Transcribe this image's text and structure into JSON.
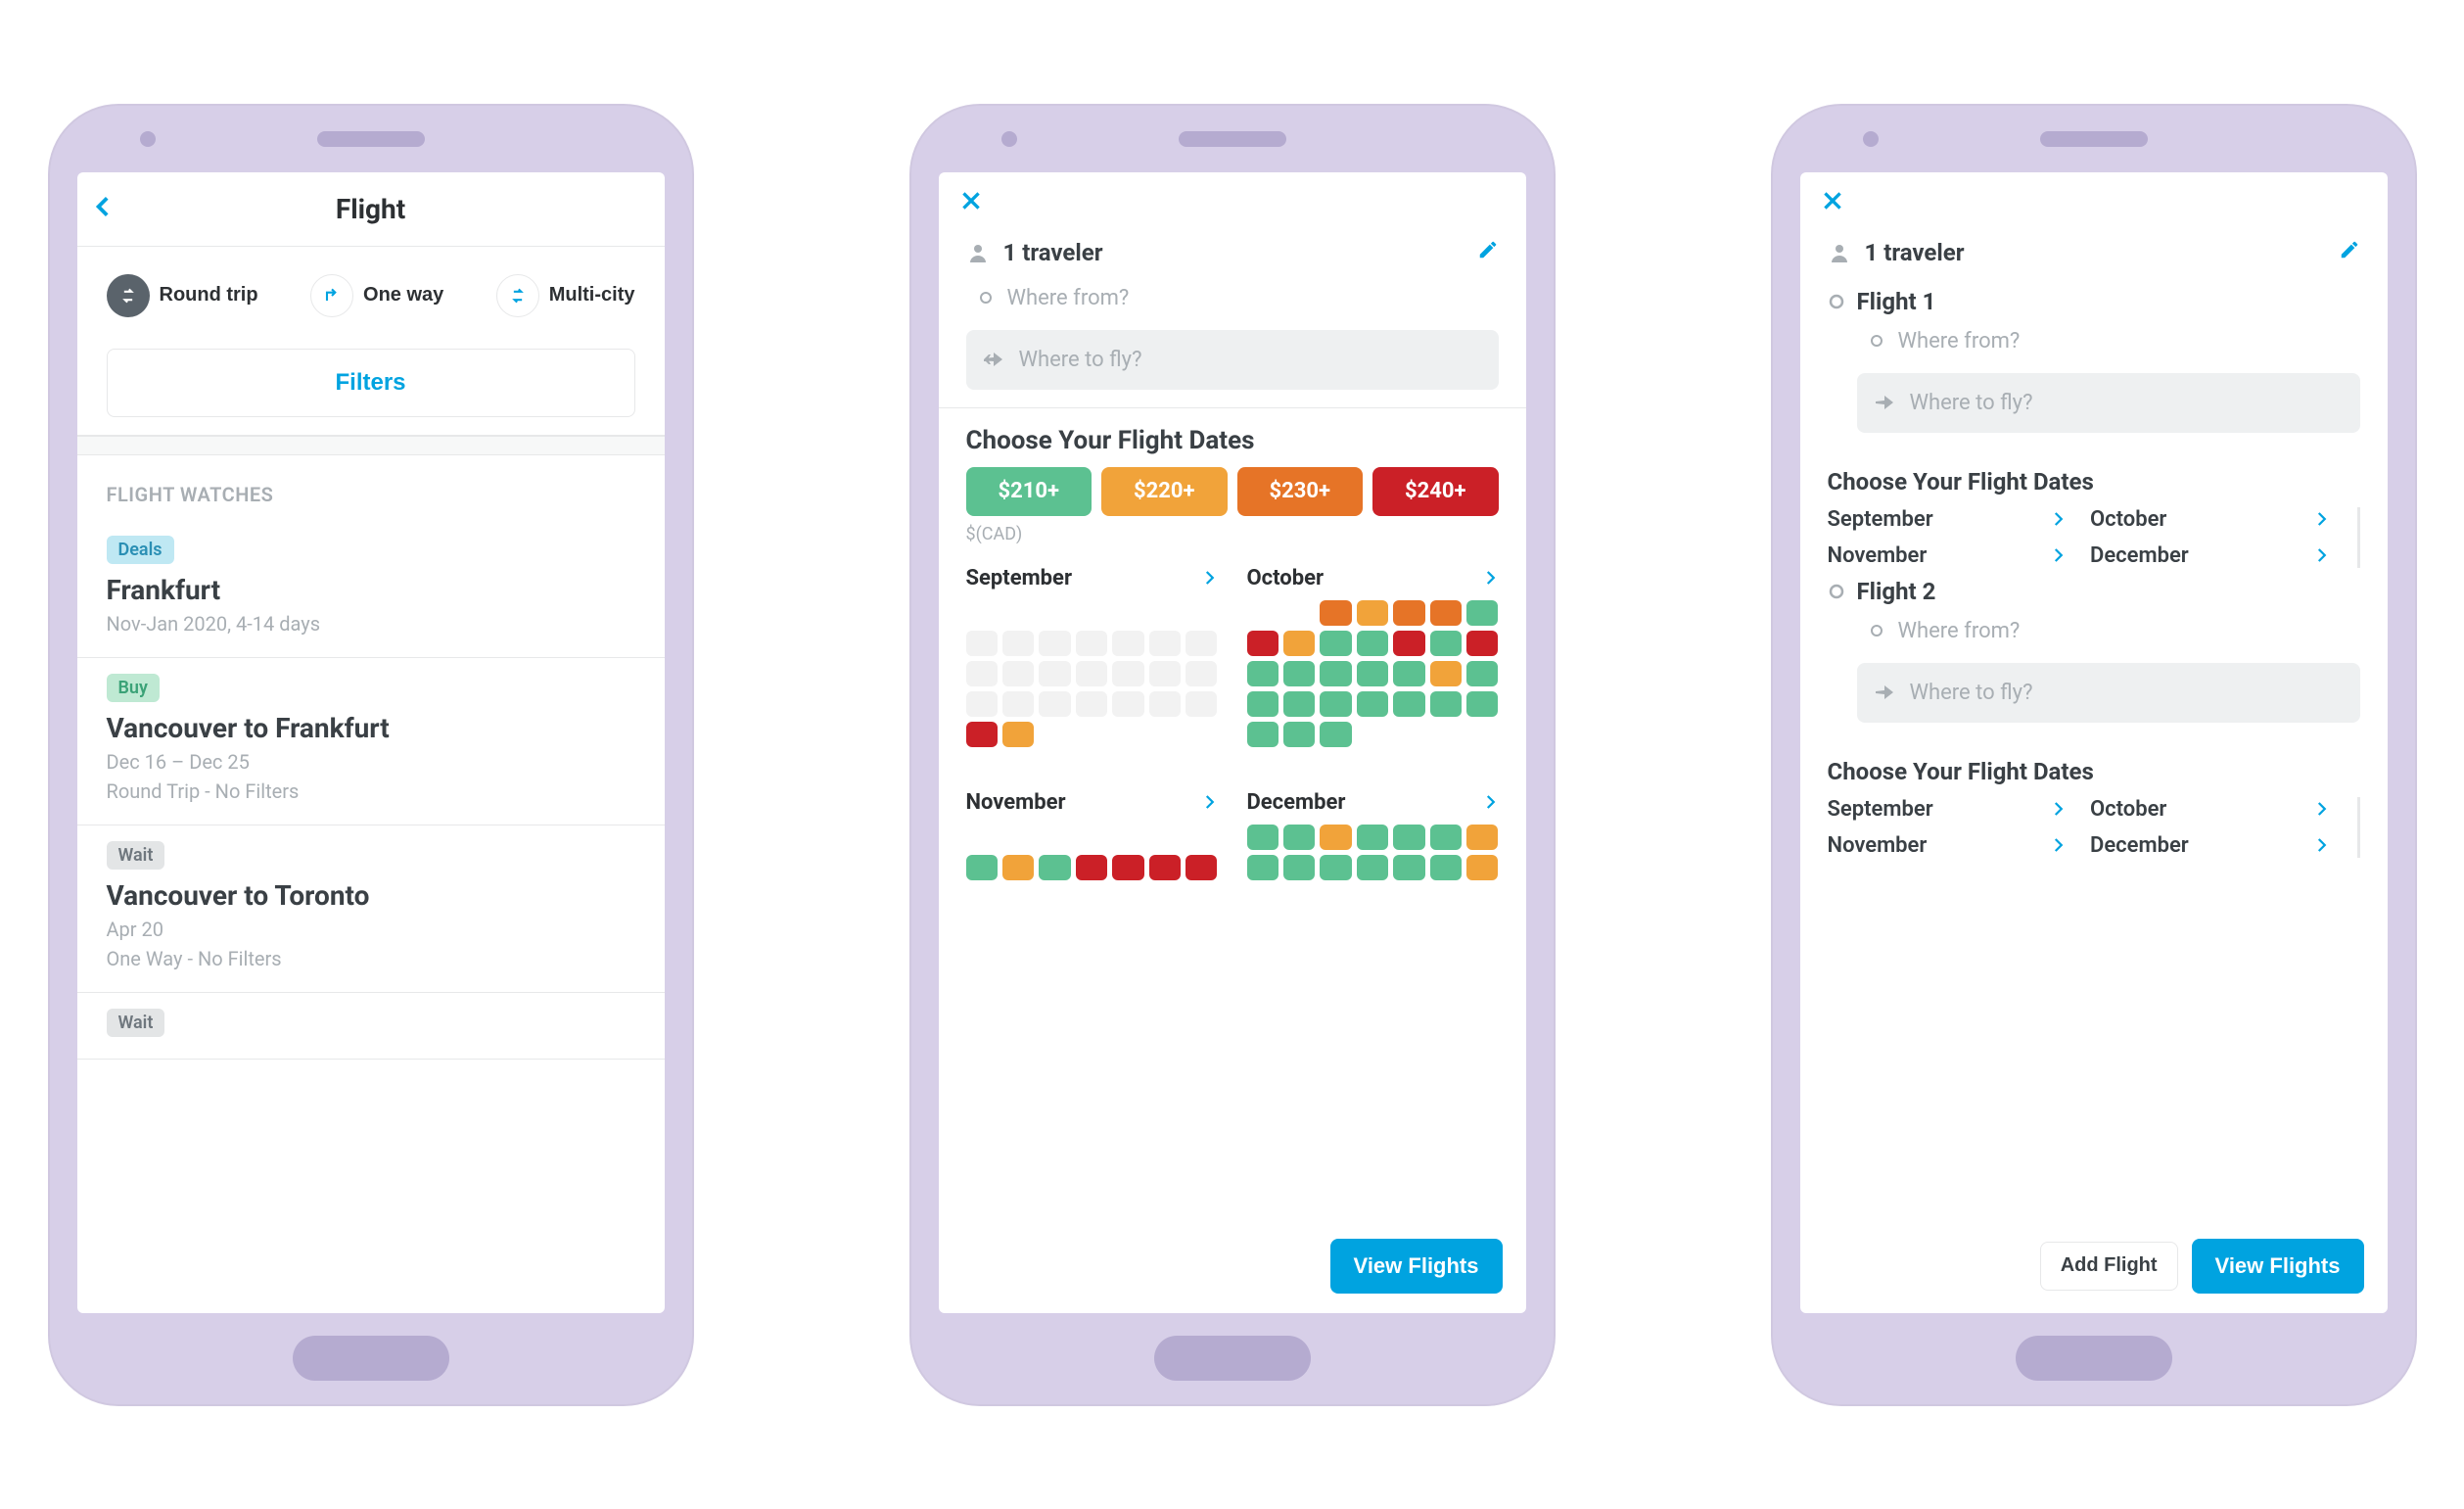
{
  "screen1": {
    "title": "Flight",
    "segments": [
      {
        "icon": "swap",
        "label": "Round trip"
      },
      {
        "icon": "corner",
        "label": "One way"
      },
      {
        "icon": "swap",
        "label": "Multi-city"
      }
    ],
    "filtersLabel": "Filters",
    "watchesHeader": "FLIGHT WATCHES",
    "watches": [
      {
        "badgeType": "deals",
        "badge": "Deals",
        "dest": "Frankfurt",
        "meta1": "Nov-Jan 2020, 4-14 days",
        "meta2": ""
      },
      {
        "badgeType": "buy",
        "badge": "Buy",
        "dest": "Vancouver to Frankfurt",
        "meta1": "Dec 16 – Dec 25",
        "meta2": "Round Trip - No Filters"
      },
      {
        "badgeType": "wait",
        "badge": "Wait",
        "dest": "Vancouver to Toronto",
        "meta1": "Apr 20",
        "meta2": "One Way - No Filters"
      },
      {
        "badgeType": "wait",
        "badge": "Wait",
        "dest": "",
        "meta1": "",
        "meta2": ""
      }
    ]
  },
  "screen2": {
    "traveler": "1 traveler",
    "fromPh": "Where from?",
    "toPh": "Where to fly?",
    "chooseDates": "Choose Your Flight Dates",
    "chips": [
      "$210+",
      "$220+",
      "$230+",
      "$240+"
    ],
    "currency": "$(CAD)",
    "months": [
      {
        "name": "September",
        "cells": [
          "",
          "",
          "",
          "",
          "",
          "",
          "",
          "e",
          "e",
          "e",
          "e",
          "e",
          "e",
          "e",
          "e",
          "e",
          "e",
          "e",
          "e",
          "e",
          "e",
          "e",
          "e",
          "e",
          "e",
          "e",
          "e",
          "e",
          "r",
          "y",
          "",
          "",
          "",
          "",
          ""
        ]
      },
      {
        "name": "October",
        "cells": [
          "",
          "",
          "o",
          "y",
          "o",
          "o",
          "g",
          "r",
          "y",
          "g",
          "g",
          "r",
          "g",
          "r",
          "g",
          "g",
          "g",
          "g",
          "g",
          "y",
          "g",
          "g",
          "g",
          "g",
          "g",
          "g",
          "g",
          "g",
          "g",
          "g",
          "g",
          "",
          "",
          "",
          ""
        ]
      },
      {
        "name": "November",
        "cells": [
          "",
          "",
          "",
          "",
          "",
          "",
          "",
          "g",
          "y",
          "g",
          "r",
          "r",
          "r",
          "r"
        ]
      },
      {
        "name": "December",
        "cells": [
          "g",
          "g",
          "y",
          "g",
          "g",
          "g",
          "y",
          "g",
          "g",
          "g",
          "g",
          "g",
          "g",
          "y"
        ]
      }
    ],
    "viewFlights": "View Flights"
  },
  "screen3": {
    "traveler": "1 traveler",
    "flights": [
      {
        "name": "Flight 1",
        "fromPh": "Where from?",
        "toPh": "Where to fly?"
      },
      {
        "name": "Flight 2",
        "fromPh": "Where from?",
        "toPh": "Where to fly?"
      }
    ],
    "chooseDates": "Choose Your Flight Dates",
    "monthLinks": [
      "September",
      "October",
      "November",
      "December"
    ],
    "addFlight": "Add Flight",
    "viewFlights": "View Flights"
  }
}
